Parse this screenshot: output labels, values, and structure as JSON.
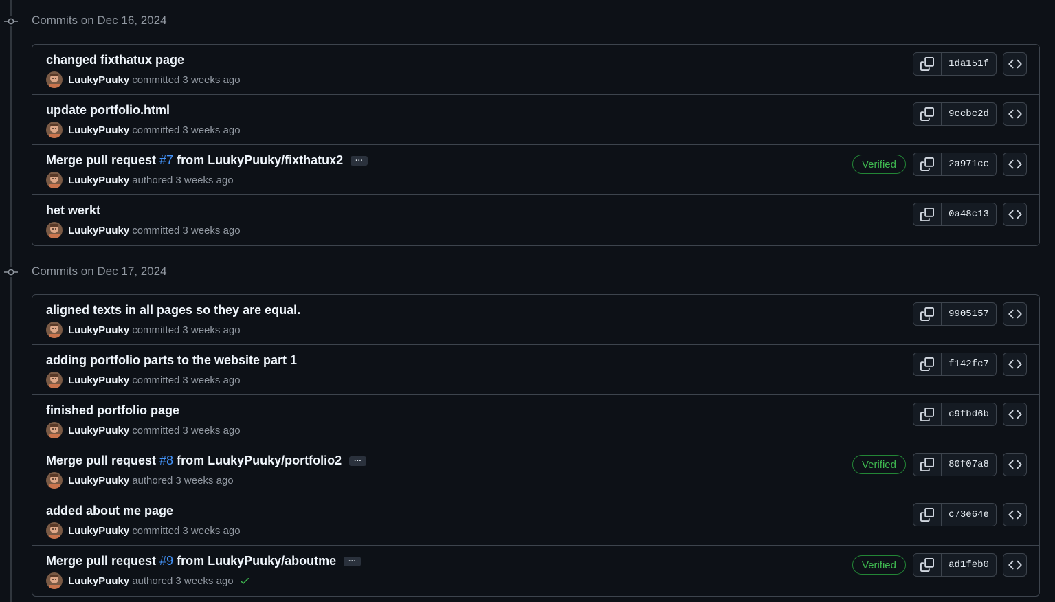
{
  "groups": [
    {
      "title": "Commits on Dec 16, 2024",
      "commits": [
        {
          "title": "changed fixthatux page",
          "author": "LuukyPuuky",
          "action": "committed",
          "time": "3 weeks ago",
          "sha": "1da151f",
          "verified": false
        },
        {
          "title": "update portfolio.html",
          "author": "LuukyPuuky",
          "action": "committed",
          "time": "3 weeks ago",
          "sha": "9ccbc2d",
          "verified": false
        },
        {
          "title_prefix": "Merge pull request ",
          "pr": "#7",
          "title_suffix": " from LuukyPuuky/fixthatux2",
          "ellipsis": "···",
          "author": "LuukyPuuky",
          "action": "authored",
          "time": "3 weeks ago",
          "sha": "2a971cc",
          "verified": true,
          "verified_label": "Verified"
        },
        {
          "title": "het werkt",
          "author": "LuukyPuuky",
          "action": "committed",
          "time": "3 weeks ago",
          "sha": "0a48c13",
          "verified": false
        }
      ]
    },
    {
      "title": "Commits on Dec 17, 2024",
      "commits": [
        {
          "title": "aligned texts in all pages so they are equal.",
          "author": "LuukyPuuky",
          "action": "committed",
          "time": "3 weeks ago",
          "sha": "9905157",
          "verified": false
        },
        {
          "title": "adding portfolio parts to the website part 1",
          "author": "LuukyPuuky",
          "action": "committed",
          "time": "3 weeks ago",
          "sha": "f142fc7",
          "verified": false
        },
        {
          "title": "finished portfolio page",
          "author": "LuukyPuuky",
          "action": "committed",
          "time": "3 weeks ago",
          "sha": "c9fbd6b",
          "verified": false
        },
        {
          "title_prefix": "Merge pull request ",
          "pr": "#8",
          "title_suffix": " from LuukyPuuky/portfolio2",
          "ellipsis": "···",
          "author": "LuukyPuuky",
          "action": "authored",
          "time": "3 weeks ago",
          "sha": "80f07a8",
          "verified": true,
          "verified_label": "Verified"
        },
        {
          "title": "added about me page",
          "author": "LuukyPuuky",
          "action": "committed",
          "time": "3 weeks ago",
          "sha": "c73e64e",
          "verified": false
        },
        {
          "title_prefix": "Merge pull request ",
          "pr": "#9",
          "title_suffix": " from LuukyPuuky/aboutme",
          "ellipsis": "···",
          "author": "LuukyPuuky",
          "action": "authored",
          "time": "3 weeks ago",
          "sha": "ad1feb0",
          "verified": true,
          "verified_label": "Verified",
          "checks": "check-icon"
        }
      ]
    }
  ],
  "icons": {
    "commit_node": "git-commit-icon",
    "copy": "copy-icon",
    "browse": "code-icon",
    "status": "check-icon"
  },
  "colors": {
    "background": "#0d1117",
    "border": "#3d444d",
    "verified": "#3fb950",
    "link": "#4493f8",
    "muted": "#9198a1"
  }
}
